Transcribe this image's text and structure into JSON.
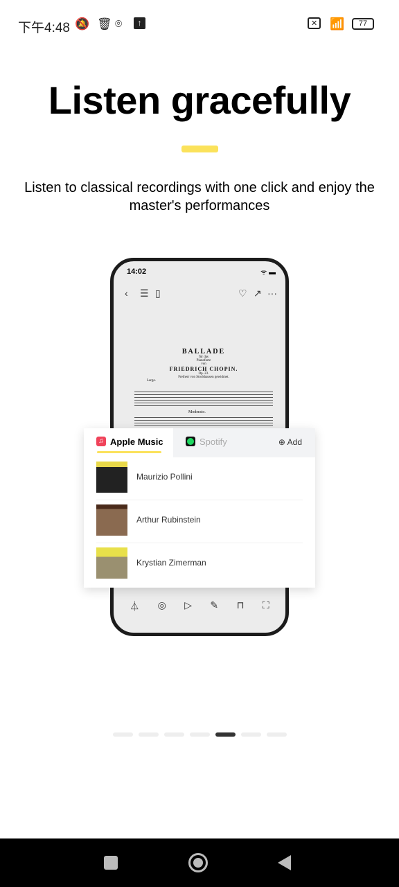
{
  "status": {
    "time": "下午4:48",
    "battery": "77"
  },
  "onboarding": {
    "title": "Listen gracefully",
    "subtitle": "Listen to classical recordings with one click and enjoy the master's performances",
    "page_index": 5,
    "page_count": 7,
    "accent_color": "#fbe25b"
  },
  "mock_phone": {
    "time": "14:02",
    "score": {
      "title": "BALLADE",
      "for": "für das",
      "instrument": "Pianoforte",
      "by": "von",
      "composer": "FRIEDRICH CHOPIN.",
      "opus": "Op. 23.",
      "dedication": "Freiherr von Stockhausen gewidmet.",
      "tempo1": "Largo.",
      "tempo2": "Moderato."
    },
    "card": {
      "tabs": [
        {
          "label": "Apple Music"
        },
        {
          "label": "Spotify"
        }
      ],
      "add_label": "Add",
      "recordings": [
        {
          "artist": "Maurizio Pollini"
        },
        {
          "artist": "Arthur Rubinstein"
        },
        {
          "artist": "Krystian Zimerman"
        }
      ]
    }
  }
}
